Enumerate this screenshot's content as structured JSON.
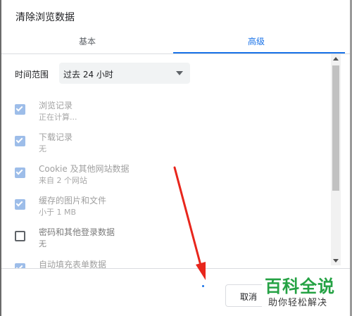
{
  "dialog": {
    "title": "清除浏览数据",
    "tabs": [
      {
        "label": "基本",
        "active": false
      },
      {
        "label": "高级",
        "active": true
      }
    ]
  },
  "time_range": {
    "label": "时间范围",
    "value": "过去 24 小时"
  },
  "items": [
    {
      "label": "浏览记录",
      "sub": "正在计算...",
      "checked": true
    },
    {
      "label": "下载记录",
      "sub": "无",
      "checked": true
    },
    {
      "label": "Cookie 及其他网站数据",
      "sub": "来自 2 个网站",
      "checked": true
    },
    {
      "label": "缓存的图片和文件",
      "sub": "小于 1 MB",
      "checked": true
    },
    {
      "label": "密码和其他登录数据",
      "sub": "无",
      "checked": false
    },
    {
      "label": "自动填充表单数据",
      "sub": "",
      "checked": true
    }
  ],
  "footer": {
    "cancel_label": "取消"
  },
  "colors": {
    "accent": "#1a73e8",
    "checkbox_checked": "#9dbde9",
    "annotation_arrow": "#e8261c",
    "watermark_green": "#25a244"
  },
  "watermark": {
    "main": "百科全说",
    "sub": "助你轻松解决"
  }
}
